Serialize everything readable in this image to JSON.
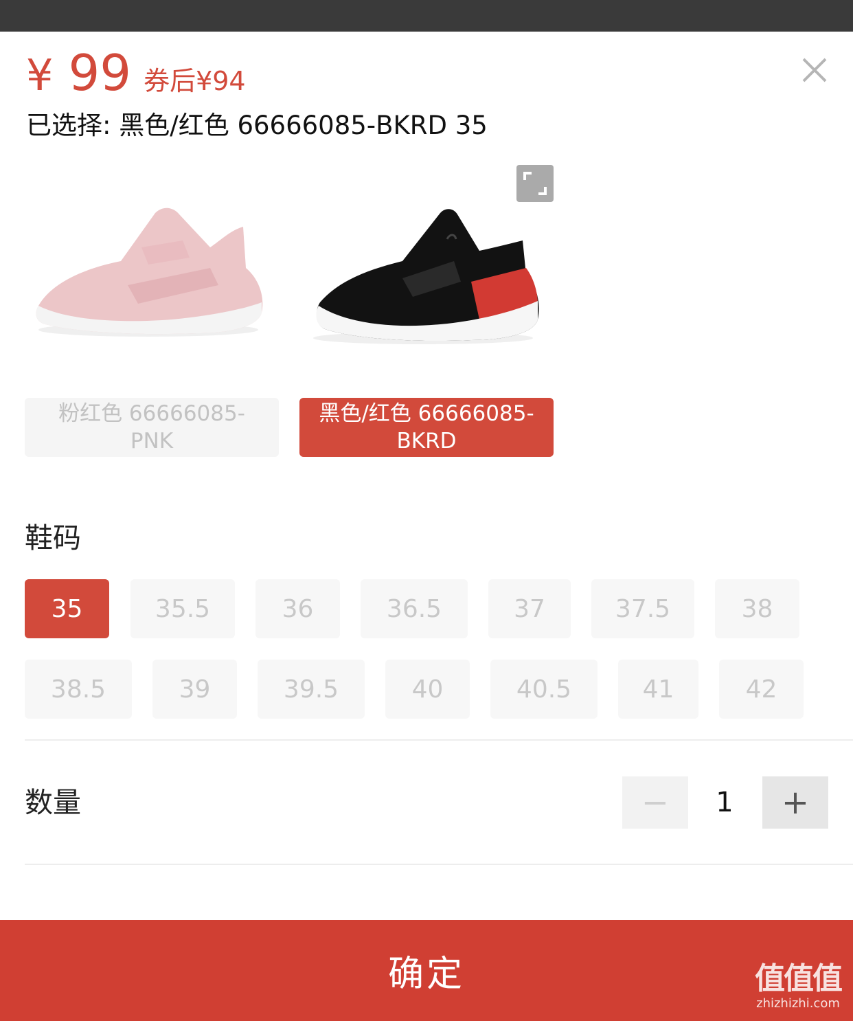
{
  "price": {
    "currency": "¥",
    "amount": "99",
    "coupon_text": "券后¥94"
  },
  "selected_text": "已选择: 黑色/红色 66666085-BKRD 35",
  "colors": [
    {
      "label": "粉红色 66666085-PNK",
      "selected": false
    },
    {
      "label": "黑色/红色 66666085-BKRD",
      "selected": true
    }
  ],
  "size_section": {
    "title": "鞋码",
    "sizes": [
      "35",
      "35.5",
      "36",
      "36.5",
      "37",
      "37.5",
      "38",
      "38.5",
      "39",
      "39.5",
      "40",
      "40.5",
      "41",
      "42"
    ],
    "selected": "35"
  },
  "quantity": {
    "title": "数量",
    "value": "1",
    "minus": "−",
    "plus": "+"
  },
  "confirm_label": "确定",
  "watermark": {
    "main": "值值值",
    "sub": "zhizhizhi.com"
  },
  "accent_color": "#d24a3b"
}
